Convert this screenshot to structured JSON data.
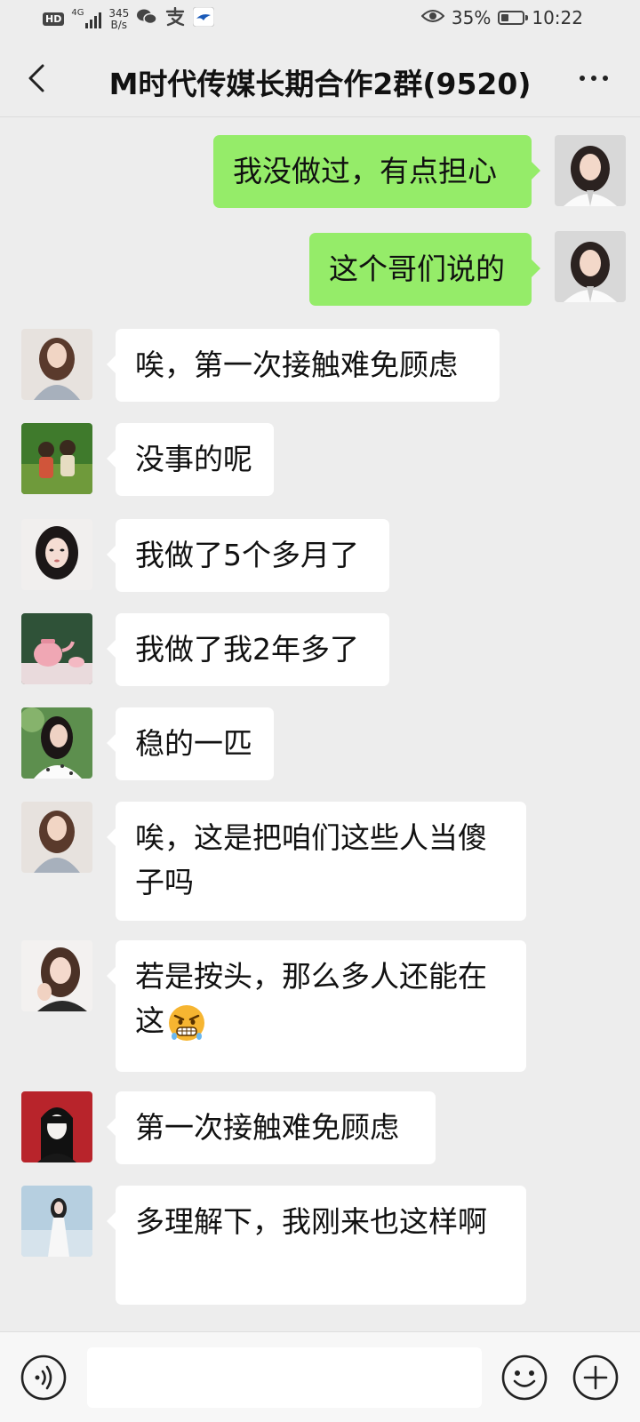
{
  "status_bar": {
    "hd": "HD",
    "network": "4G",
    "speed_value": "345",
    "speed_unit": "B/s",
    "icons": [
      "wechat-icon",
      "alipay-icon",
      "bird-app-icon"
    ],
    "battery_percent": "35%",
    "battery_level": 0.35,
    "time": "10:22"
  },
  "header": {
    "title": "M时代传媒长期合作2群(9520)"
  },
  "messages": [
    {
      "side": "sent",
      "text": "我没做过，有点担心"
    },
    {
      "side": "sent",
      "text": "这个哥们说的"
    },
    {
      "side": "recv",
      "text": "唉，第一次接触难免顾虑"
    },
    {
      "side": "recv",
      "text": "没事的呢"
    },
    {
      "side": "recv",
      "text": "我做了5个多月了"
    },
    {
      "side": "recv",
      "text": "我做了我2年多了"
    },
    {
      "side": "recv",
      "text": "稳的一匹"
    },
    {
      "side": "recv",
      "text": "唉，这是把咱们这些人当傻子吗"
    },
    {
      "side": "recv",
      "text": "若是按头，那么多人还能在这",
      "emoji": "grimacing-face-emoji"
    },
    {
      "side": "recv",
      "text": "第一次接触难免顾虑"
    },
    {
      "side": "recv",
      "text": "多理解下，我刚来也这样啊"
    }
  ],
  "input_bar": {
    "value": "",
    "icons": [
      "voice-icon",
      "emoji-icon",
      "plus-icon"
    ]
  },
  "colors": {
    "background": "#ededed",
    "sent_bubble": "#95ec69",
    "recv_bubble": "#ffffff",
    "input_bar": "#f7f7f7"
  }
}
